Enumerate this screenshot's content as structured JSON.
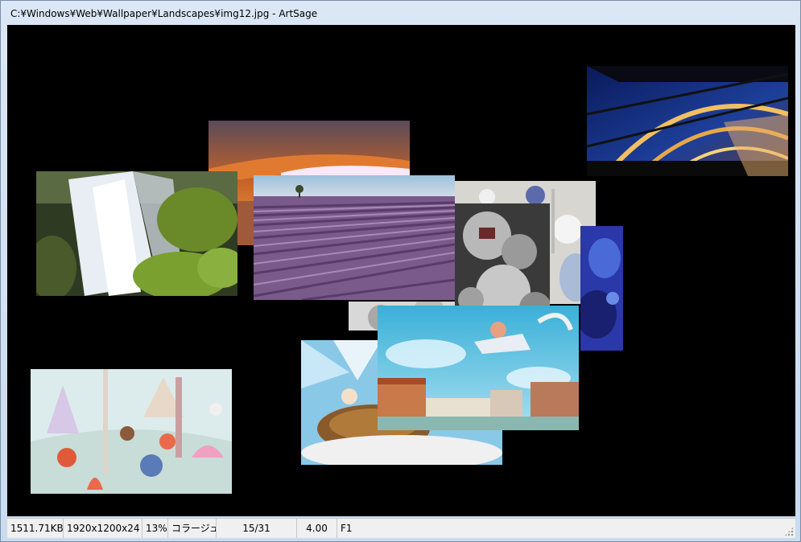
{
  "window": {
    "title": "C:¥Windows¥Web¥Wallpaper¥Landscapes¥img12.jpg - ArtSage"
  },
  "photos": [
    {
      "name": "bridge-tunnel-photo"
    },
    {
      "name": "canyon-arch-photo"
    },
    {
      "name": "waterfall-photo"
    },
    {
      "name": "lavender-field-photo"
    },
    {
      "name": "cartoon-toys-photo"
    },
    {
      "name": "blue-abstract-photo"
    },
    {
      "name": "grey-robots-photo"
    },
    {
      "name": "fairy-forest-photo"
    },
    {
      "name": "turtle-cartoon-photo"
    },
    {
      "name": "flying-hero-town-photo"
    }
  ],
  "status": {
    "file_size": "1511.71KB",
    "resolution": "1920x1200x24",
    "zoom": "13%",
    "mode": "コラージュ",
    "position": "15/31",
    "interval": "4.00",
    "key_hint": "F1"
  }
}
